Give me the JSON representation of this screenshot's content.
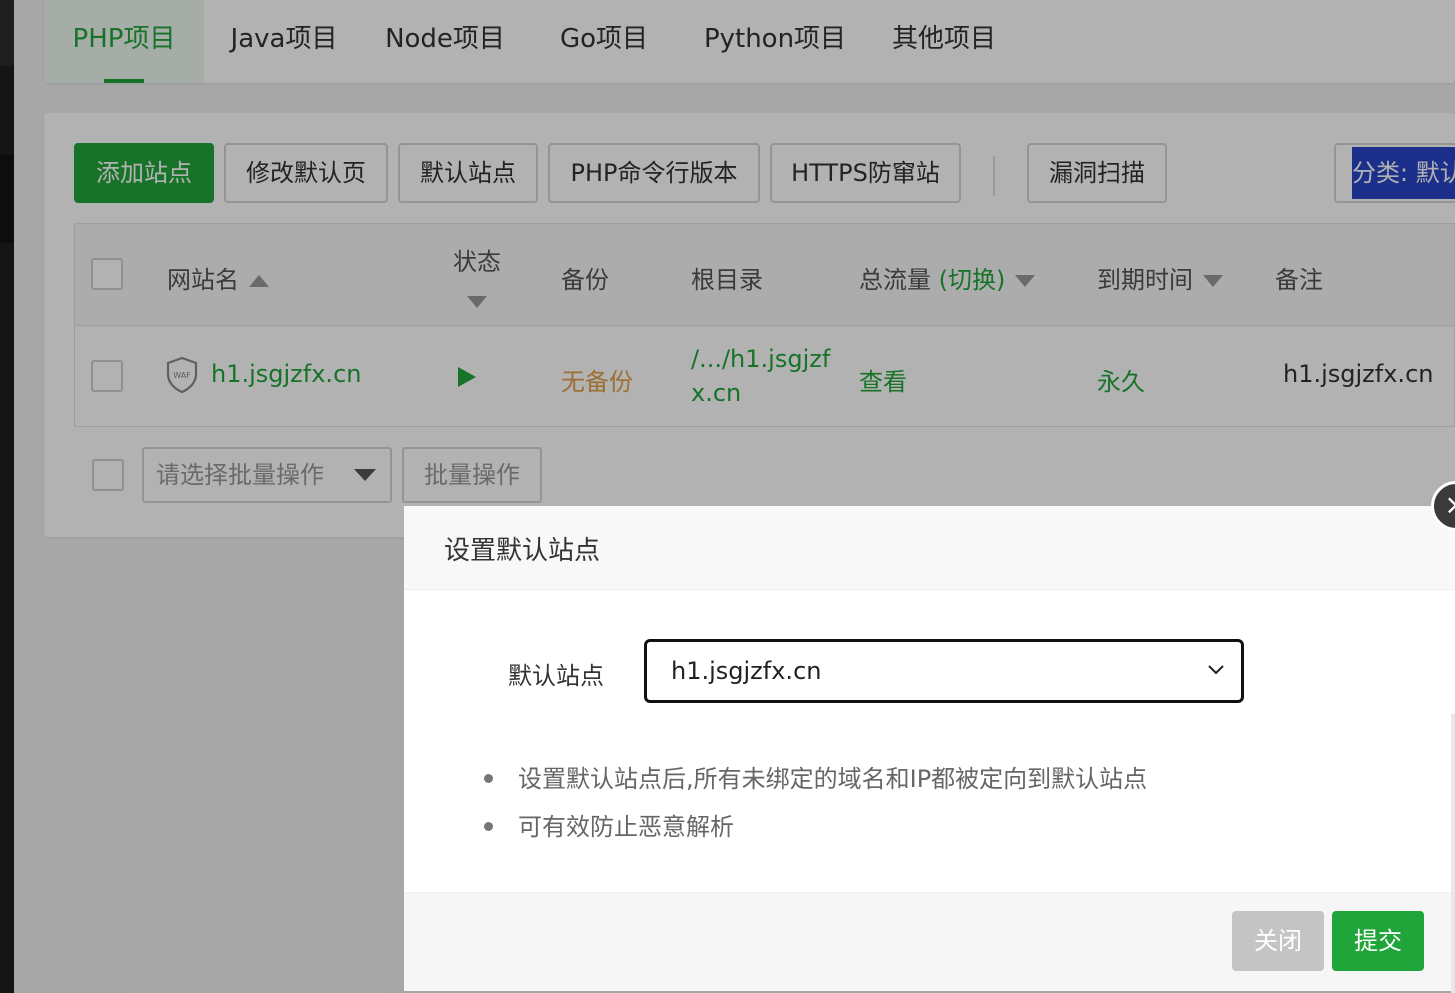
{
  "tabs": [
    {
      "label": "PHP项目",
      "active": true
    },
    {
      "label": "Java项目"
    },
    {
      "label": "Node项目"
    },
    {
      "label": "Go项目"
    },
    {
      "label": "Python项目"
    },
    {
      "label": "其他项目"
    }
  ],
  "toolbar": {
    "add_site": "添加站点",
    "edit_default_page": "修改默认页",
    "default_site": "默认站点",
    "php_cli_version": "PHP命令行版本",
    "https_anti_snoop": "HTTPS防窜站",
    "vuln_scan": "漏洞扫描",
    "category": "分类: 默认"
  },
  "table": {
    "headers": {
      "site_name": "网站名",
      "status": "状态",
      "backup": "备份",
      "root_dir": "根目录",
      "traffic": "总流量",
      "traffic_switch": "(切换)",
      "expire": "到期时间",
      "remark": "备注"
    },
    "rows": [
      {
        "site_name": "h1.jsgjzfx.cn",
        "waf_label": "WAF",
        "backup": "无备份",
        "root_dir_line1": "/.../h1.jsgjzf",
        "root_dir_line2": "x.cn",
        "traffic": "查看",
        "expire": "永久",
        "remark": "h1.jsgjzfx.cn"
      }
    ]
  },
  "batch": {
    "select_placeholder": "请选择批量操作",
    "button": "批量操作"
  },
  "modal": {
    "title": "设置默认站点",
    "field_label": "默认站点",
    "selected_site": "h1.jsgjzfx.cn",
    "tips": [
      "设置默认站点后,所有未绑定的域名和IP都被定向到默认站点",
      "可有效防止恶意解析"
    ],
    "close_button": "关闭",
    "submit_button": "提交",
    "close_icon_glyph": "×"
  },
  "colors": {
    "accent_green": "#20a53a",
    "backup_orange": "#e0a04a",
    "category_blue": "#2945c7"
  }
}
